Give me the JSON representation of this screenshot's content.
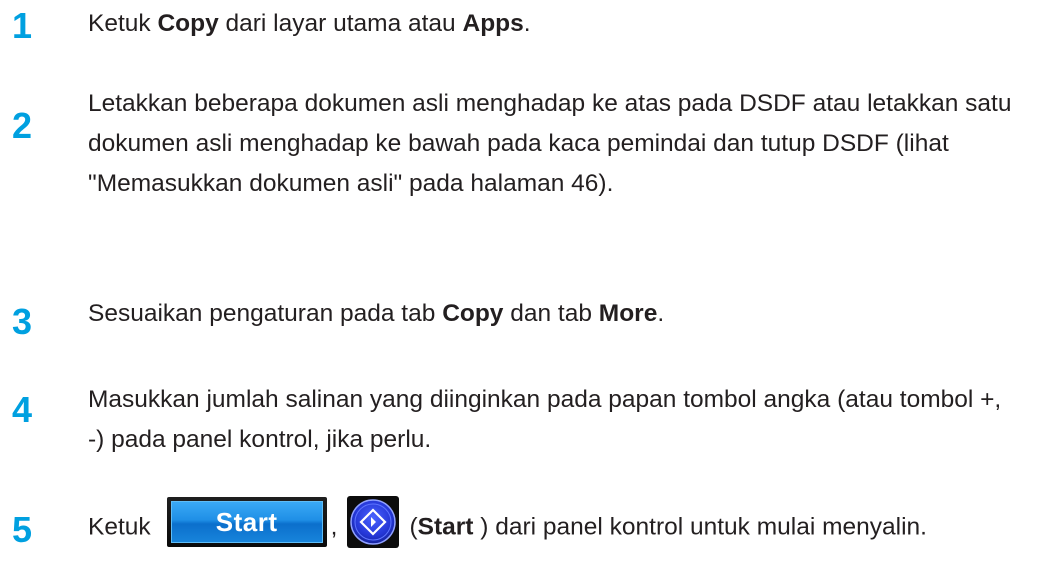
{
  "steps": [
    {
      "number": "1",
      "parts": [
        "Ketuk ",
        "Copy",
        " dari layar utama atau ",
        "Apps",
        "."
      ]
    },
    {
      "number": "2",
      "text": "Letakkan beberapa dokumen asli menghadap ke atas pada DSDF atau letakkan satu dokumen asli menghadap ke bawah pada kaca pemindai dan tutup DSDF (lihat \"Memasukkan dokumen asli\" pada halaman 46)."
    },
    {
      "number": "3",
      "parts": [
        "Sesuaikan pengaturan pada tab ",
        "Copy",
        " dan tab ",
        "More",
        "."
      ]
    },
    {
      "number": "4",
      "text": "Masukkan jumlah salinan yang diinginkan pada papan tombol angka (atau tombol +, -) pada panel kontrol, jika perlu."
    },
    {
      "number": "5",
      "parts": [
        "Ketuk",
        ",",
        "(",
        "Start",
        " ) dari panel kontrol untuk mulai menyalin."
      ],
      "start_button_label": "Start"
    }
  ],
  "colors": {
    "step_number": "#00a0e0",
    "body_text": "#231f20",
    "start_button_blue": "#1f8fe6",
    "start_key_blue": "#2a3be0"
  },
  "icons": [
    "start-screen-button-icon",
    "start-hardware-key-icon"
  ]
}
